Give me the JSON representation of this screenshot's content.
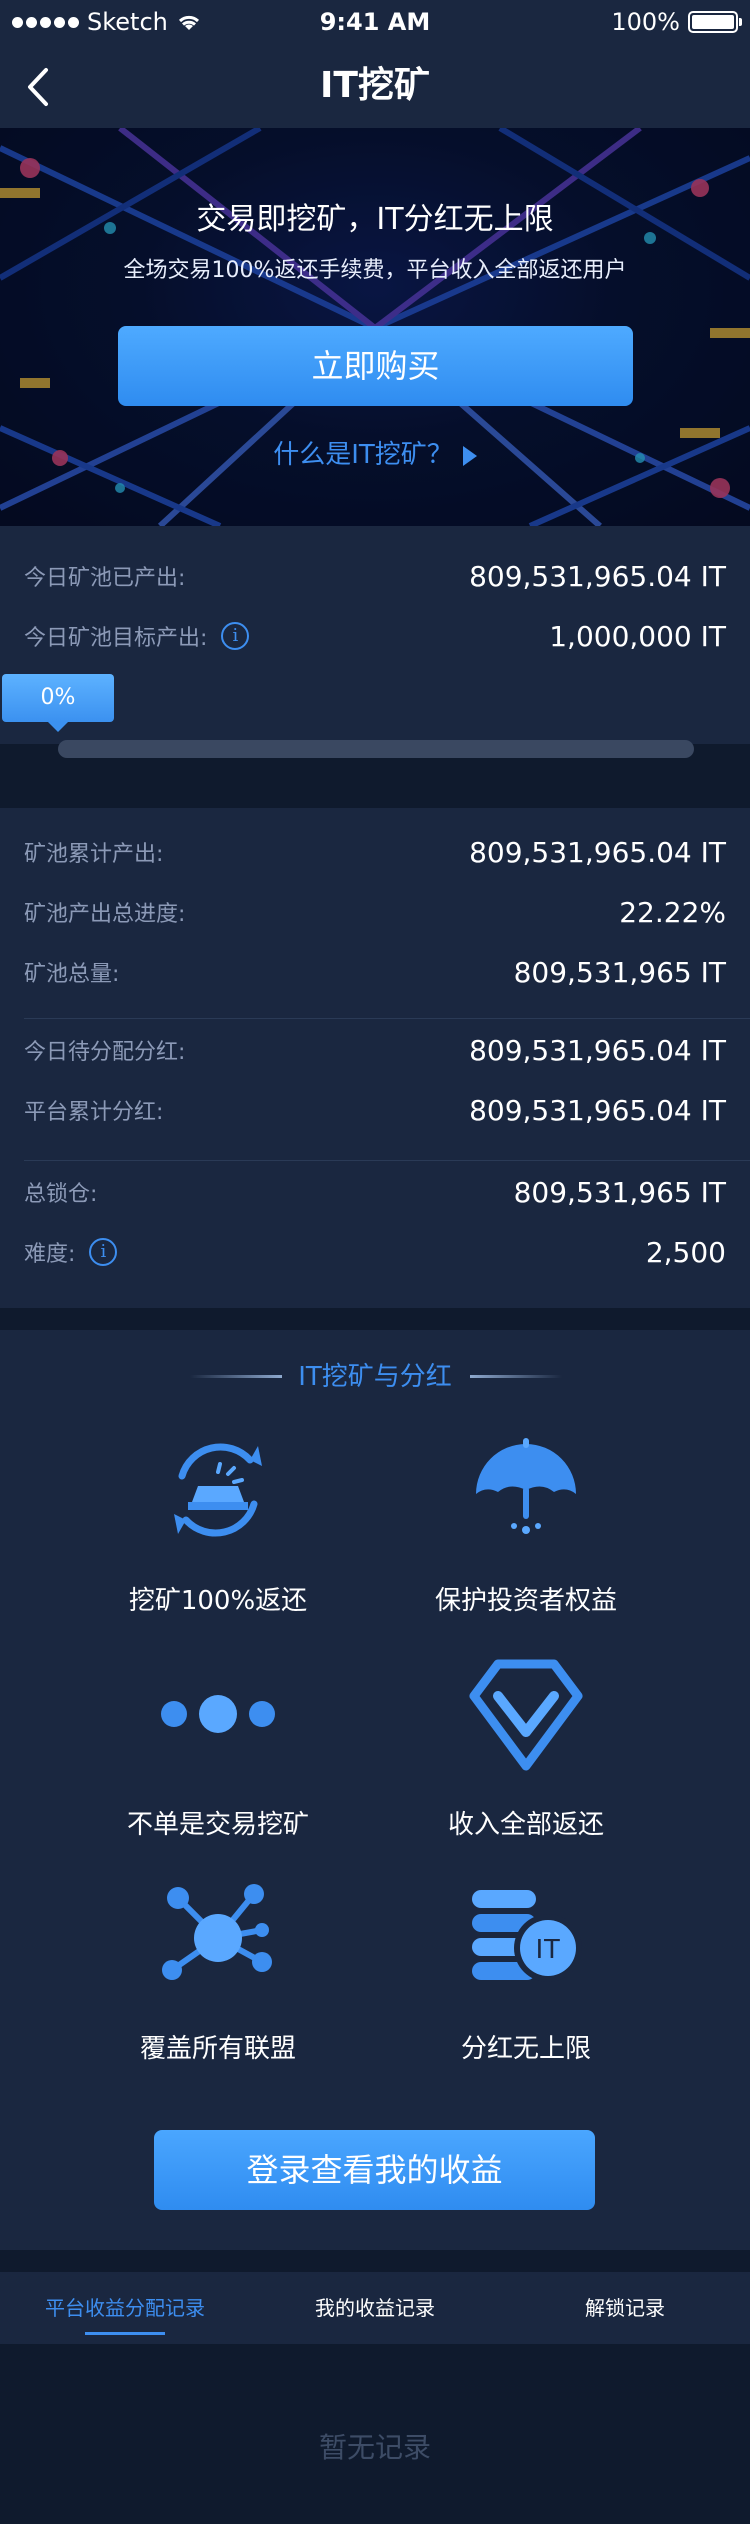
{
  "status_bar": {
    "carrier": "Sketch",
    "time": "9:41 AM",
    "battery": "100%"
  },
  "nav": {
    "title": "IT挖矿"
  },
  "banner": {
    "title": "交易即挖矿，IT分红无上限",
    "subtitle": "全场交易100%返还手续费，平台收入全部返还用户",
    "buy_button": "立即购买",
    "what_link": "什么是IT挖矿？"
  },
  "today": {
    "produced_label": "今日矿池已产出:",
    "produced_value": "809,531,965.04 IT",
    "target_label": "今日矿池目标产出:",
    "target_value": "1,000,000 IT",
    "progress_label": "0%",
    "progress_fraction": 0
  },
  "pool": {
    "cumulative_label": "矿池累计产出:",
    "cumulative_value": "809,531,965.04 IT",
    "progress_label": "矿池产出总进度:",
    "progress_value": "22.22%",
    "total_label": "矿池总量:",
    "total_value": "809,531,965 IT",
    "today_dividend_label": "今日待分配分红:",
    "today_dividend_value": "809,531,965.04 IT",
    "platform_dividend_label": "平台累计分红:",
    "platform_dividend_value": "809,531,965.04 IT",
    "locked_label": "总锁仓:",
    "locked_value": "809,531,965 IT",
    "difficulty_label": "难度:",
    "difficulty_value": "2,500"
  },
  "features": {
    "title": "IT挖矿与分红",
    "items": [
      {
        "label": "挖矿100%返还",
        "icon": "mining-return-icon"
      },
      {
        "label": "保护投资者权益",
        "icon": "umbrella-icon"
      },
      {
        "label": "不单是交易挖矿",
        "icon": "dots-icon"
      },
      {
        "label": "收入全部返还",
        "icon": "diamond-icon"
      },
      {
        "label": "覆盖所有联盟",
        "icon": "network-icon"
      },
      {
        "label": "分红无上限",
        "icon": "coins-it-icon"
      }
    ],
    "coin_text": "IT",
    "login_button": "登录查看我的收益"
  },
  "tabs": [
    {
      "label": "平台收益分配记录",
      "active": true
    },
    {
      "label": "我的收益记录",
      "active": false
    },
    {
      "label": "解锁记录",
      "active": false
    }
  ],
  "empty_text": "暂无记录",
  "colors": {
    "accent": "#3d8ef0",
    "card_bg": "#1a2740",
    "page_bg": "#0f1a2d"
  }
}
